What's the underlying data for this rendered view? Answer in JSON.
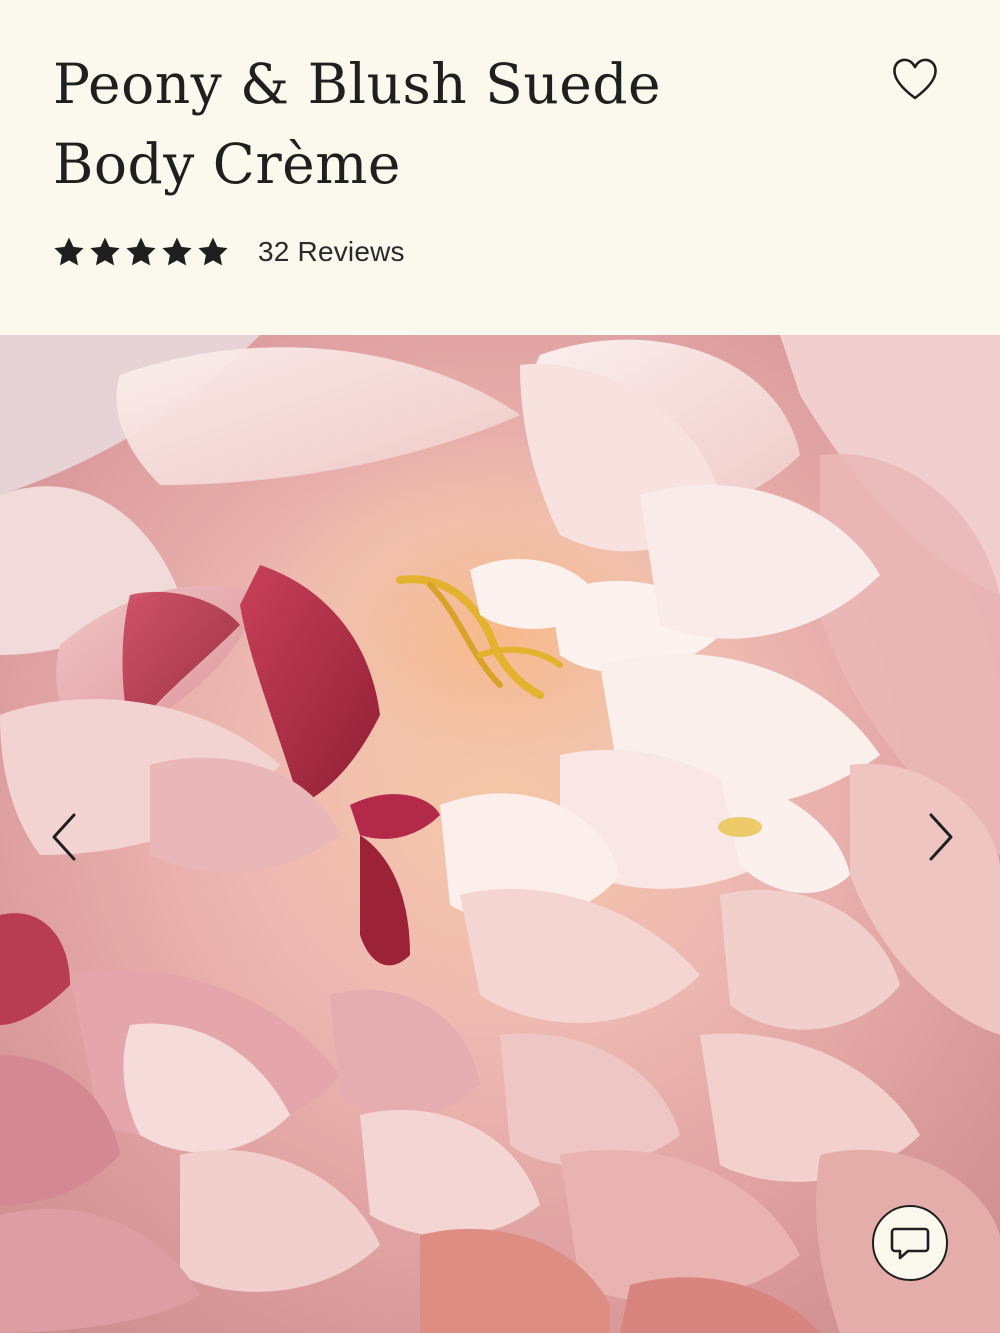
{
  "product": {
    "title_line1": "Peony & Blush Suede",
    "title_line2": "Body Crème",
    "rating_stars": 5,
    "rating_max": 5,
    "reviews_label": "32 Reviews"
  },
  "icons": {
    "wishlist": "heart-outline-icon",
    "prev": "chevron-left-icon",
    "next": "chevron-right-icon",
    "chat": "chat-bubble-icon",
    "star": "star-filled-icon"
  },
  "colors": {
    "background": "#fbf9ee",
    "text": "#1f1f1f",
    "photo_base": "#e9b9b6"
  }
}
